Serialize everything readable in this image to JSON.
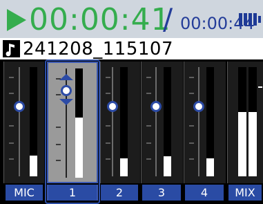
{
  "header": {
    "elapsed_time": "00:00:41",
    "separator": "/",
    "total_time": "00:00:44",
    "state_icon": "play-icon",
    "battery_icon": "battery-icon",
    "colors": {
      "elapsed": "#35ad4e",
      "total": "#243d99",
      "bar_bg": "#cfd6de"
    }
  },
  "file": {
    "icon": "music-note-icon",
    "name": "241208_115107"
  },
  "mixer": {
    "selected_channel": "1",
    "channels": [
      {
        "label": "MIC",
        "fader_level": 0.83,
        "meter_level": 0.18
      },
      {
        "label": "1",
        "fader_level": 0.85,
        "meter_level": 0.55
      },
      {
        "label": "2",
        "fader_level": 0.83,
        "meter_level": 0.16
      },
      {
        "label": "3",
        "fader_level": 0.83,
        "meter_level": 0.18
      },
      {
        "label": "4",
        "fader_level": 0.83,
        "meter_level": 0.16
      },
      {
        "label": "MIX",
        "meter_level": 0.6
      }
    ]
  }
}
